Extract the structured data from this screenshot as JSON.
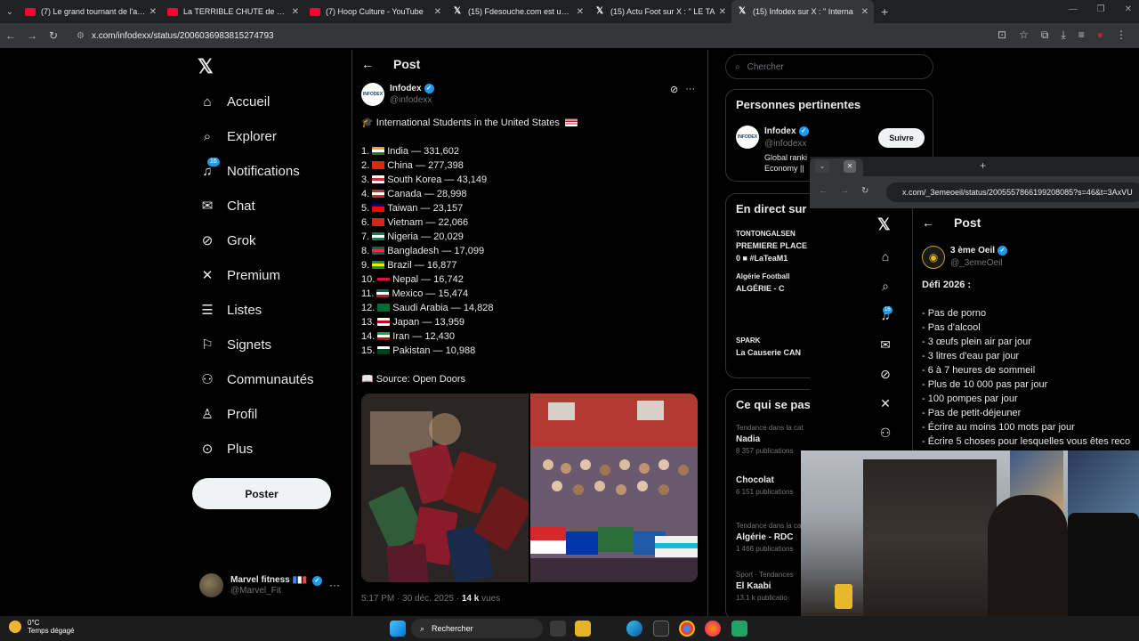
{
  "browser": {
    "tabs": [
      {
        "title": "(7) Le grand tournant de l'anim",
        "kind": "yt"
      },
      {
        "title": "La TERRIBLE CHUTE de ONE PI",
        "kind": "yt"
      },
      {
        "title": "(7) Hoop Culture - YouTube",
        "kind": "yt"
      },
      {
        "title": "(15) Fdesouche.com est une re",
        "kind": "x"
      },
      {
        "title": "(15) Actu Foot sur X : \" LE TA",
        "kind": "x"
      },
      {
        "title": "(15) Infodex sur X : \" Interna",
        "kind": "x",
        "active": true
      }
    ],
    "url": "x.com/infodexx/status/2006036983815274793"
  },
  "sidebar": {
    "items": [
      {
        "label": "Accueil",
        "icon": "home-icon"
      },
      {
        "label": "Explorer",
        "icon": "search-icon"
      },
      {
        "label": "Notifications",
        "icon": "bell-icon",
        "badge": "16"
      },
      {
        "label": "Chat",
        "icon": "mail-icon"
      },
      {
        "label": "Grok",
        "icon": "grok-icon"
      },
      {
        "label": "Premium",
        "icon": "x-icon"
      },
      {
        "label": "Listes",
        "icon": "list-icon"
      },
      {
        "label": "Signets",
        "icon": "bookmark-icon"
      },
      {
        "label": "Communautés",
        "icon": "communities-icon"
      },
      {
        "label": "Profil",
        "icon": "profile-icon"
      },
      {
        "label": "Plus",
        "icon": "more-icon"
      }
    ],
    "post_button": "Poster",
    "account": {
      "name": "Marvel fitness",
      "handle": "@Marvel_Fit"
    }
  },
  "post": {
    "header_title": "Post",
    "author": {
      "name": "Infodex",
      "handle": "@infodexx",
      "avatar_text": "INFODEX"
    },
    "headline": "International Students in the United States",
    "list": [
      {
        "rank": "1.",
        "country": "India",
        "value": "331,602",
        "flag": [
          "#ff9933",
          "#ffffff",
          "#138808"
        ]
      },
      {
        "rank": "2.",
        "country": "China",
        "value": "277,398",
        "flag": [
          "#de2910",
          "#de2910",
          "#de2910"
        ]
      },
      {
        "rank": "3.",
        "country": "South Korea",
        "value": "43,149",
        "flag": [
          "#ffffff",
          "#cd2e3a",
          "#ffffff"
        ]
      },
      {
        "rank": "4.",
        "country": "Canada",
        "value": "28,998",
        "flag": [
          "#d52b1e",
          "#ffffff",
          "#d52b1e"
        ]
      },
      {
        "rank": "5.",
        "country": "Taiwan",
        "value": "23,157",
        "flag": [
          "#000095",
          "#fe0000",
          "#fe0000"
        ]
      },
      {
        "rank": "6.",
        "country": "Vietnam",
        "value": "22,066",
        "flag": [
          "#da251d",
          "#da251d",
          "#da251d"
        ]
      },
      {
        "rank": "7.",
        "country": "Nigeria",
        "value": "20,029",
        "flag": [
          "#008751",
          "#ffffff",
          "#008751"
        ]
      },
      {
        "rank": "8.",
        "country": "Bangladesh",
        "value": "17,099",
        "flag": [
          "#006a4e",
          "#f42a41",
          "#006a4e"
        ]
      },
      {
        "rank": "9.",
        "country": "Brazil",
        "value": "16,877",
        "flag": [
          "#009c3b",
          "#ffdf00",
          "#009c3b"
        ]
      },
      {
        "rank": "10.",
        "country": "Nepal",
        "value": "16,742",
        "flag": [
          "#000000",
          "#dc143c",
          "#000000"
        ]
      },
      {
        "rank": "11.",
        "country": "Mexico",
        "value": "15,474",
        "flag": [
          "#006847",
          "#ffffff",
          "#ce1126"
        ]
      },
      {
        "rank": "12.",
        "country": "Saudi Arabia",
        "value": "14,828",
        "flag": [
          "#006c35",
          "#006c35",
          "#006c35"
        ]
      },
      {
        "rank": "13.",
        "country": "Japan",
        "value": "13,959",
        "flag": [
          "#ffffff",
          "#bc002d",
          "#ffffff"
        ]
      },
      {
        "rank": "14.",
        "country": "Iran",
        "value": "12,430",
        "flag": [
          "#239f40",
          "#ffffff",
          "#da0000"
        ]
      },
      {
        "rank": "15.",
        "country": "Pakistan",
        "value": "10,988",
        "flag": [
          "#ffffff",
          "#01411c",
          "#01411c"
        ]
      }
    ],
    "source": "Source: Open Doors",
    "time": "5:17 PM · 30 déc. 2025 ·",
    "views_count": "14 k",
    "views_label": "vues"
  },
  "right": {
    "search_placeholder": "Chercher",
    "relevant": {
      "title": "Personnes pertinentes",
      "name": "Infodex",
      "handle": "@infodexx",
      "bio_line1": "Global ranki",
      "bio_line2": "Economy ||",
      "follow": "Suivre"
    },
    "live": {
      "title": "En direct sur",
      "items": [
        {
          "source": "TONTONGALSEN",
          "title": "PREMIERE PLACE",
          "sub": "0 ■ #LaTeaM1"
        },
        {
          "source": "Algérie Football",
          "title": "ALGÉRIE - C",
          "sub": ""
        },
        {
          "source": "SPARK",
          "title": "La Causerie CAN",
          "sub": ""
        }
      ]
    },
    "trends": {
      "title": "Ce qui se pas",
      "items": [
        {
          "context": "Tendance dans la cat",
          "name": "Nadia",
          "count": "8 357 publications"
        },
        {
          "context": "",
          "name": "Chocolat",
          "count": "6 151 publications"
        },
        {
          "context": "Tendance dans la ca",
          "name": "Algérie - RDC",
          "count": "1 466 publications"
        },
        {
          "context": "Sport · Tendances",
          "name": "El Kaabi",
          "count": "13,1 k publicatio"
        }
      ]
    }
  },
  "floating": {
    "url": "x.com/_3emeoeil/status/2005557866199208085?s=46&t=3AxVU",
    "header_title": "Post",
    "author": {
      "name": "3 ème Oeil",
      "handle": "@_3emeOeil"
    },
    "notif_badge": "16",
    "lines": [
      "Défi 2026 :",
      "",
      "- Pas de porno",
      "- Pas d'alcool",
      "- 3 œufs plein air par jour",
      "- 3 litres d'eau par jour",
      "- 6 à 7 heures de sommeil",
      "- Plus de 10 000 pas par jour",
      "- 100 pompes par jour",
      "- Pas de petit-déjeuner",
      "- Écrire au moins 100 mots par jour",
      "- Écrire 5 choses pour lesquelles vous êtes reco"
    ]
  },
  "taskbar": {
    "temp": "0°C",
    "weather": "Temps dégagé",
    "search": "Rechercher"
  }
}
